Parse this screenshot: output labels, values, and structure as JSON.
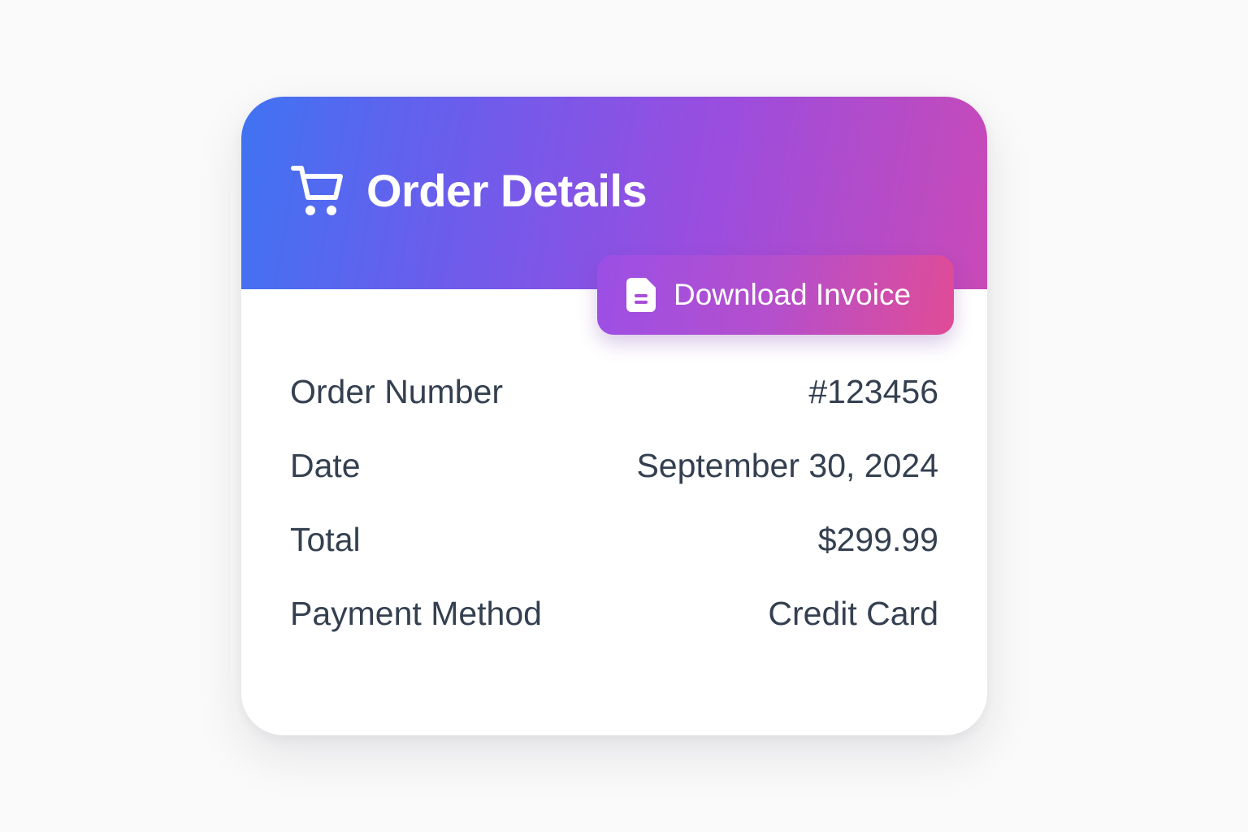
{
  "card": {
    "title": "Order Details",
    "title_icon": "shopping-cart-icon",
    "download_button": {
      "label": "Download Invoice",
      "icon": "document-icon"
    }
  },
  "details": [
    {
      "label": "Order Number",
      "value": "#123456"
    },
    {
      "label": "Date",
      "value": "September 30, 2024"
    },
    {
      "label": "Total",
      "value": "$299.99"
    },
    {
      "label": "Payment Method",
      "value": "Credit Card"
    }
  ],
  "colors": {
    "header_gradient_start": "#3f73f2",
    "header_gradient_end": "#c94ab7",
    "button_gradient_start": "#9b4fe6",
    "button_gradient_end": "#e04c96",
    "text": "#344050",
    "background": "#fafafa"
  }
}
